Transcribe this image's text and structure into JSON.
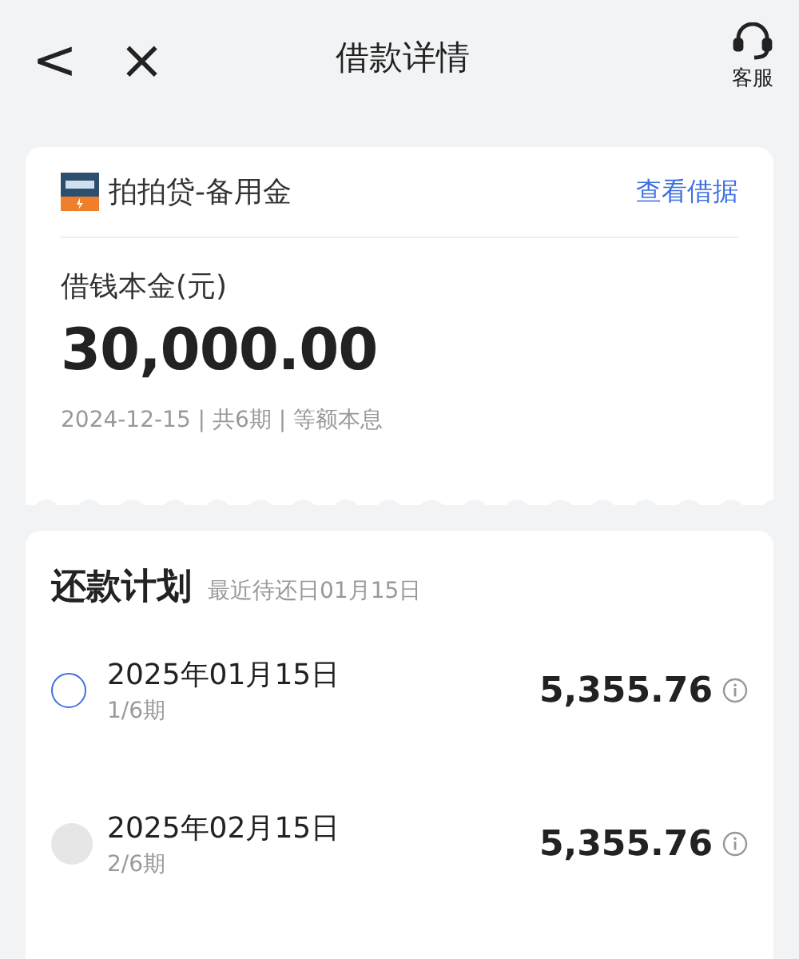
{
  "header": {
    "back": "<",
    "close": "×",
    "title": "借款详情",
    "service_label": "客服"
  },
  "loan": {
    "product": "拍拍贷-备用金",
    "link": "查看借据",
    "principal_label": "借钱本金(元)",
    "principal": "30,000.00",
    "meta": "2024-12-15 | 共6期 | 等额本息"
  },
  "plan": {
    "title": "还款计划",
    "subtitle": "最近待还日01月15日",
    "installments": [
      {
        "date": "2025年01月15日",
        "period": "1/6期",
        "amount": "5,355.76",
        "current": true
      },
      {
        "date": "2025年02月15日",
        "period": "2/6期",
        "amount": "5,355.76",
        "current": false
      }
    ]
  }
}
